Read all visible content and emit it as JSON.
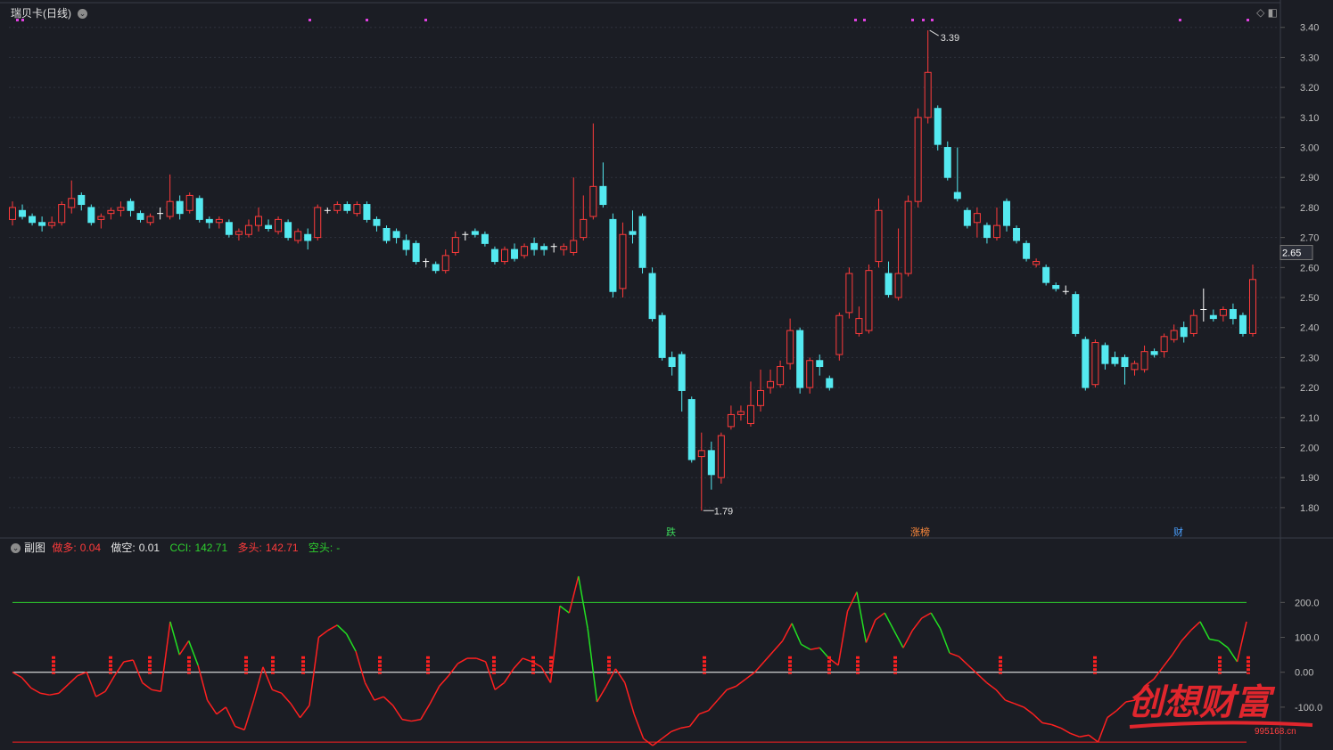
{
  "header": {
    "stock_title": "瑞贝卡(日线)",
    "sub_chart_label": "副图",
    "ind": [
      {
        "name": "做多:",
        "value": "0.04",
        "color": "#ff3b3b"
      },
      {
        "name": "做空:",
        "value": "0.01",
        "color": "#e6e6e6"
      },
      {
        "name": "CCI:",
        "value": "142.71",
        "color": "#2ed12e"
      },
      {
        "name": "多头:",
        "value": "142.71",
        "color": "#ff3b3b"
      },
      {
        "name": "空头:",
        "value": "-",
        "color": "#2ed12e"
      }
    ]
  },
  "price_axis": {
    "ticks": [
      "3.40",
      "3.30",
      "3.20",
      "3.10",
      "3.00",
      "2.90",
      "2.80",
      "2.70",
      "2.60",
      "2.50",
      "2.40",
      "2.30",
      "2.20",
      "2.10",
      "2.00",
      "1.90",
      "1.80"
    ],
    "current_price": "2.65"
  },
  "markers": {
    "high_label": "3.39",
    "low_label": "1.79",
    "events": [
      "跌",
      "涨榜",
      "财"
    ]
  },
  "cci_axis": {
    "ticks": [
      "200.0",
      "100.0",
      "0.00",
      "-100.0"
    ]
  },
  "watermark": {
    "text": "创想财富",
    "url": "995168.cn"
  },
  "colors": {
    "up": "#ff3b3b",
    "down": "#54e9f0",
    "cci_red": "#ff2020",
    "cci_green": "#22e022",
    "bg": "#1b1d24"
  },
  "chart_data": [
    {
      "type": "candlestick",
      "title": "瑞贝卡(日线)",
      "ylim": [
        1.77,
        3.42
      ],
      "candles": [
        [
          2.76,
          2.8,
          2.74,
          2.82
        ],
        [
          2.79,
          2.77,
          2.76,
          2.81
        ],
        [
          2.77,
          2.75,
          2.74,
          2.78
        ],
        [
          2.75,
          2.74,
          2.72,
          2.77
        ],
        [
          2.74,
          2.75,
          2.73,
          2.77
        ],
        [
          2.75,
          2.81,
          2.74,
          2.82
        ],
        [
          2.8,
          2.83,
          2.78,
          2.89
        ],
        [
          2.84,
          2.81,
          2.79,
          2.85
        ],
        [
          2.8,
          2.75,
          2.74,
          2.81
        ],
        [
          2.76,
          2.77,
          2.73,
          2.78
        ],
        [
          2.78,
          2.79,
          2.76,
          2.8
        ],
        [
          2.79,
          2.8,
          2.77,
          2.82
        ],
        [
          2.82,
          2.79,
          2.77,
          2.83
        ],
        [
          2.78,
          2.76,
          2.75,
          2.79
        ],
        [
          2.75,
          2.77,
          2.74,
          2.78
        ],
        [
          2.78,
          2.78,
          2.76,
          2.8
        ],
        [
          2.77,
          2.82,
          2.76,
          2.91
        ],
        [
          2.82,
          2.78,
          2.76,
          2.84
        ],
        [
          2.79,
          2.84,
          2.78,
          2.85
        ],
        [
          2.83,
          2.76,
          2.75,
          2.84
        ],
        [
          2.76,
          2.75,
          2.73,
          2.77
        ],
        [
          2.75,
          2.76,
          2.73,
          2.77
        ],
        [
          2.75,
          2.71,
          2.7,
          2.76
        ],
        [
          2.71,
          2.72,
          2.69,
          2.73
        ],
        [
          2.71,
          2.74,
          2.7,
          2.76
        ],
        [
          2.74,
          2.77,
          2.72,
          2.8
        ],
        [
          2.74,
          2.73,
          2.72,
          2.76
        ],
        [
          2.72,
          2.76,
          2.71,
          2.77
        ],
        [
          2.75,
          2.7,
          2.69,
          2.76
        ],
        [
          2.69,
          2.72,
          2.68,
          2.73
        ],
        [
          2.71,
          2.69,
          2.66,
          2.73
        ],
        [
          2.7,
          2.8,
          2.69,
          2.81
        ],
        [
          2.79,
          2.79,
          2.78,
          2.8
        ],
        [
          2.79,
          2.81,
          2.78,
          2.82
        ],
        [
          2.81,
          2.79,
          2.78,
          2.82
        ],
        [
          2.78,
          2.81,
          2.77,
          2.82
        ],
        [
          2.81,
          2.76,
          2.75,
          2.82
        ],
        [
          2.76,
          2.74,
          2.72,
          2.77
        ],
        [
          2.73,
          2.69,
          2.68,
          2.74
        ],
        [
          2.72,
          2.7,
          2.68,
          2.73
        ],
        [
          2.69,
          2.66,
          2.64,
          2.71
        ],
        [
          2.68,
          2.62,
          2.61,
          2.69
        ],
        [
          2.62,
          2.62,
          2.6,
          2.63
        ],
        [
          2.61,
          2.59,
          2.58,
          2.62
        ],
        [
          2.59,
          2.64,
          2.58,
          2.66
        ],
        [
          2.65,
          2.7,
          2.64,
          2.72
        ],
        [
          2.71,
          2.71,
          2.69,
          2.72
        ],
        [
          2.72,
          2.71,
          2.7,
          2.73
        ],
        [
          2.71,
          2.68,
          2.67,
          2.72
        ],
        [
          2.66,
          2.62,
          2.61,
          2.67
        ],
        [
          2.62,
          2.66,
          2.61,
          2.67
        ],
        [
          2.66,
          2.63,
          2.62,
          2.68
        ],
        [
          2.64,
          2.67,
          2.63,
          2.68
        ],
        [
          2.68,
          2.66,
          2.64,
          2.7
        ],
        [
          2.67,
          2.66,
          2.64,
          2.68
        ],
        [
          2.67,
          2.67,
          2.65,
          2.68
        ],
        [
          2.66,
          2.67,
          2.64,
          2.68
        ],
        [
          2.65,
          2.69,
          2.64,
          2.9
        ],
        [
          2.7,
          2.76,
          2.69,
          2.84
        ],
        [
          2.77,
          2.87,
          2.76,
          3.08
        ],
        [
          2.87,
          2.81,
          2.8,
          2.95
        ],
        [
          2.76,
          2.52,
          2.5,
          2.78
        ],
        [
          2.53,
          2.71,
          2.5,
          2.75
        ],
        [
          2.72,
          2.71,
          2.68,
          2.79
        ],
        [
          2.77,
          2.6,
          2.58,
          2.78
        ],
        [
          2.58,
          2.43,
          2.42,
          2.6
        ],
        [
          2.44,
          2.3,
          2.29,
          2.45
        ],
        [
          2.3,
          2.27,
          2.24,
          2.32
        ],
        [
          2.31,
          2.19,
          2.12,
          2.32
        ],
        [
          2.16,
          1.96,
          1.95,
          2.17
        ],
        [
          1.97,
          1.99,
          1.79,
          2.05
        ],
        [
          1.99,
          1.91,
          1.86,
          2.02
        ],
        [
          1.9,
          2.04,
          1.88,
          2.05
        ],
        [
          2.07,
          2.11,
          2.06,
          2.14
        ],
        [
          2.11,
          2.12,
          2.09,
          2.14
        ],
        [
          2.08,
          2.14,
          2.07,
          2.22
        ],
        [
          2.14,
          2.19,
          2.12,
          2.26
        ],
        [
          2.2,
          2.22,
          2.18,
          2.26
        ],
        [
          2.21,
          2.27,
          2.2,
          2.29
        ],
        [
          2.28,
          2.39,
          2.26,
          2.43
        ],
        [
          2.39,
          2.2,
          2.18,
          2.4
        ],
        [
          2.2,
          2.29,
          2.18,
          2.3
        ],
        [
          2.29,
          2.27,
          2.24,
          2.31
        ],
        [
          2.23,
          2.2,
          2.19,
          2.24
        ],
        [
          2.31,
          2.44,
          2.29,
          2.45
        ],
        [
          2.45,
          2.58,
          2.43,
          2.6
        ],
        [
          2.38,
          2.43,
          2.37,
          2.47
        ],
        [
          2.39,
          2.59,
          2.38,
          2.61
        ],
        [
          2.62,
          2.79,
          2.6,
          2.83
        ],
        [
          2.58,
          2.51,
          2.5,
          2.62
        ],
        [
          2.5,
          2.58,
          2.49,
          2.73
        ],
        [
          2.58,
          2.82,
          2.57,
          2.84
        ],
        [
          2.82,
          3.1,
          2.8,
          3.13
        ],
        [
          3.1,
          3.25,
          3.08,
          3.39
        ],
        [
          3.13,
          3.01,
          2.99,
          3.14
        ],
        [
          3.0,
          2.9,
          2.89,
          3.02
        ],
        [
          2.85,
          2.83,
          2.82,
          3.0
        ],
        [
          2.79,
          2.74,
          2.73,
          2.8
        ],
        [
          2.75,
          2.78,
          2.7,
          2.8
        ],
        [
          2.74,
          2.7,
          2.68,
          2.75
        ],
        [
          2.7,
          2.74,
          2.69,
          2.8
        ],
        [
          2.82,
          2.74,
          2.72,
          2.83
        ],
        [
          2.73,
          2.69,
          2.68,
          2.74
        ],
        [
          2.68,
          2.63,
          2.62,
          2.69
        ],
        [
          2.61,
          2.62,
          2.6,
          2.63
        ],
        [
          2.6,
          2.55,
          2.54,
          2.61
        ],
        [
          2.54,
          2.53,
          2.52,
          2.55
        ],
        [
          2.52,
          2.52,
          2.51,
          2.54
        ],
        [
          2.51,
          2.38,
          2.37,
          2.52
        ],
        [
          2.36,
          2.2,
          2.19,
          2.37
        ],
        [
          2.21,
          2.35,
          2.2,
          2.36
        ],
        [
          2.34,
          2.28,
          2.26,
          2.35
        ],
        [
          2.3,
          2.28,
          2.27,
          2.32
        ],
        [
          2.3,
          2.27,
          2.21,
          2.31
        ],
        [
          2.26,
          2.28,
          2.24,
          2.29
        ],
        [
          2.26,
          2.32,
          2.25,
          2.34
        ],
        [
          2.32,
          2.31,
          2.3,
          2.33
        ],
        [
          2.32,
          2.37,
          2.3,
          2.38
        ],
        [
          2.36,
          2.39,
          2.35,
          2.41
        ],
        [
          2.4,
          2.37,
          2.35,
          2.42
        ],
        [
          2.38,
          2.44,
          2.37,
          2.46
        ],
        [
          2.46,
          2.46,
          2.42,
          2.53
        ],
        [
          2.44,
          2.43,
          2.42,
          2.46
        ],
        [
          2.44,
          2.46,
          2.42,
          2.47
        ],
        [
          2.46,
          2.43,
          2.41,
          2.48
        ],
        [
          2.44,
          2.38,
          2.37,
          2.45
        ],
        [
          2.38,
          2.56,
          2.37,
          2.61
        ]
      ]
    },
    {
      "type": "line",
      "title": "CCI",
      "ylim": [
        -210,
        280
      ],
      "series": [
        {
          "name": "CCI",
          "values": [
            0,
            -15,
            -45,
            -60,
            -65,
            -60,
            -35,
            -10,
            0,
            -70,
            -55,
            -10,
            30,
            35,
            -30,
            -50,
            -55,
            145,
            50,
            90,
            20,
            -80,
            -120,
            -100,
            -155,
            -165,
            -80,
            15,
            -50,
            -60,
            -90,
            -130,
            -95,
            100,
            120,
            135,
            110,
            60,
            -30,
            -80,
            -70,
            -95,
            -135,
            -140,
            -135,
            -90,
            -40,
            -10,
            25,
            40,
            40,
            30,
            -50,
            -30,
            10,
            40,
            30,
            15,
            -30,
            190,
            170,
            275,
            125,
            -85,
            -40,
            10,
            -30,
            -120,
            -190,
            -210,
            -190,
            -170,
            -160,
            -155,
            -120,
            -110,
            -80,
            -50,
            -40,
            -20,
            0,
            30,
            60,
            90,
            140,
            80,
            65,
            70,
            40,
            20,
            175,
            230,
            85,
            150,
            170,
            120,
            70,
            120,
            155,
            170,
            125,
            55,
            45,
            20,
            -5,
            -30,
            -50,
            -80,
            -90,
            -100,
            -120,
            -145,
            -150,
            -160,
            -175,
            -185,
            -180,
            -200,
            -130,
            -110,
            -85,
            -80,
            -40,
            -20,
            15,
            50,
            90,
            120,
            145,
            95,
            90,
            70,
            30,
            145
          ]
        }
      ],
      "reference_lines": [
        200,
        0,
        -200
      ]
    }
  ]
}
